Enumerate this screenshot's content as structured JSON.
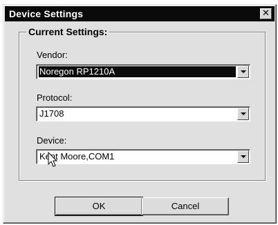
{
  "window": {
    "title": "Device Settings"
  },
  "group": {
    "legend": "Current Settings:",
    "vendor": {
      "label": "Vendor:",
      "value": "Noregon RP1210A"
    },
    "protocol": {
      "label": "Protocol:",
      "value": "J1708"
    },
    "device": {
      "label": "Device:",
      "value": "Kent Moore,COM1"
    }
  },
  "buttons": {
    "ok": "OK",
    "cancel": "Cancel"
  },
  "icons": {
    "close": "close-icon",
    "dropdown": "chevron-down-icon",
    "cursor": "mouse-pointer-icon"
  },
  "colors": {
    "titlebar": "#0a0a0a",
    "selection": "#0b0b0b",
    "face": "#e0e0e0"
  }
}
